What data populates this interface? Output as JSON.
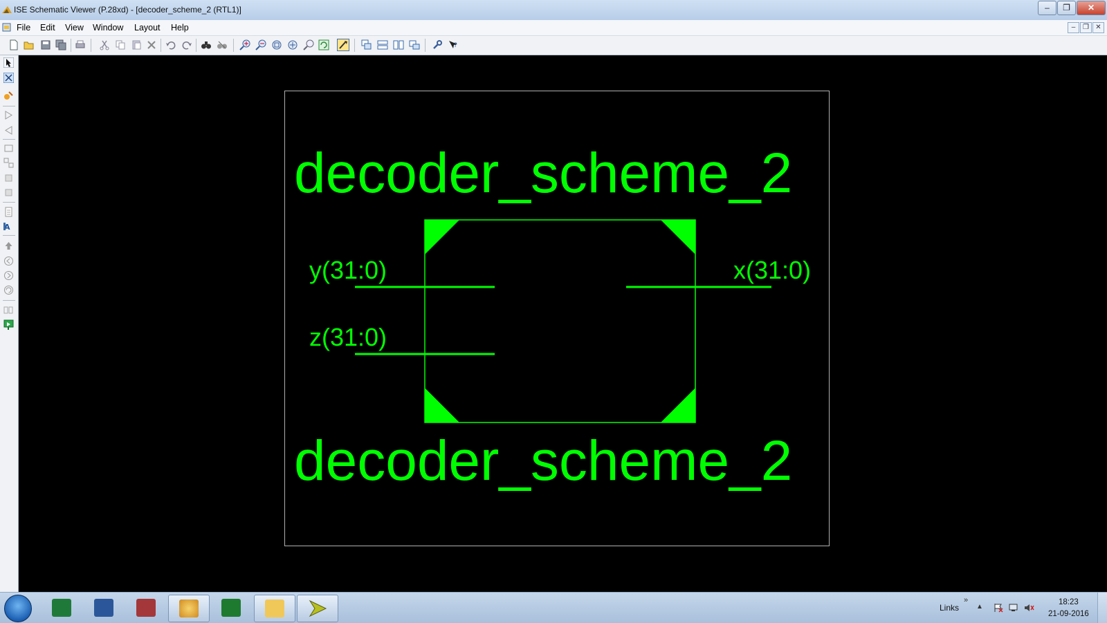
{
  "window": {
    "title": "ISE Schematic Viewer (P.28xd) - [decoder_scheme_2 (RTL1)]",
    "controls": {
      "minimize": "–",
      "restore": "❐",
      "close": "✕"
    }
  },
  "menu": {
    "items": [
      "File",
      "Edit",
      "View",
      "Window",
      "Layout",
      "Help"
    ],
    "mdi_controls": {
      "minimize": "–",
      "restore": "❐",
      "close": "✕"
    }
  },
  "toolbar": {
    "buttons": [
      "new-file",
      "open-folder",
      "save",
      "save-all",
      "print",
      "cut",
      "copy",
      "paste",
      "delete",
      "undo",
      "redo",
      "find",
      "find-replace",
      "zoom-in",
      "zoom-out",
      "zoom-full",
      "zoom-fit",
      "zoom-selection",
      "refresh",
      "pan-active",
      "cascade-windows",
      "tile-horizontal",
      "tile-vertical",
      "tile-windows",
      "properties-wrench",
      "whats-this-help"
    ]
  },
  "left_tools": [
    "select-arrow",
    "hierarchy-view",
    "add-component",
    "previous",
    "next",
    "block",
    "instance",
    "net",
    "port",
    "bus",
    "properties",
    "add-text",
    "push-into",
    "back",
    "forward",
    "refresh",
    "pin",
    "green-flag"
  ],
  "schematic": {
    "symbol_name_top": "decoder_scheme_2",
    "symbol_name_bottom": "decoder_scheme_2",
    "pins": {
      "y": "y(31:0)",
      "z": "z(31:0)",
      "x": "x(31:0)"
    },
    "colors": {
      "background": "#000000",
      "symbol": "#00ff00",
      "frame": "#b0b0b0"
    }
  },
  "taskbar": {
    "apps": [
      "excel",
      "word",
      "access",
      "paint",
      "vim",
      "explorer",
      "xilinx-ise"
    ],
    "links_label": "Links",
    "links_more": "»",
    "tray_icons": [
      "action-center-flag",
      "network",
      "volume-muted"
    ],
    "clock": {
      "time": "18:23",
      "date": "21-09-2016"
    }
  }
}
